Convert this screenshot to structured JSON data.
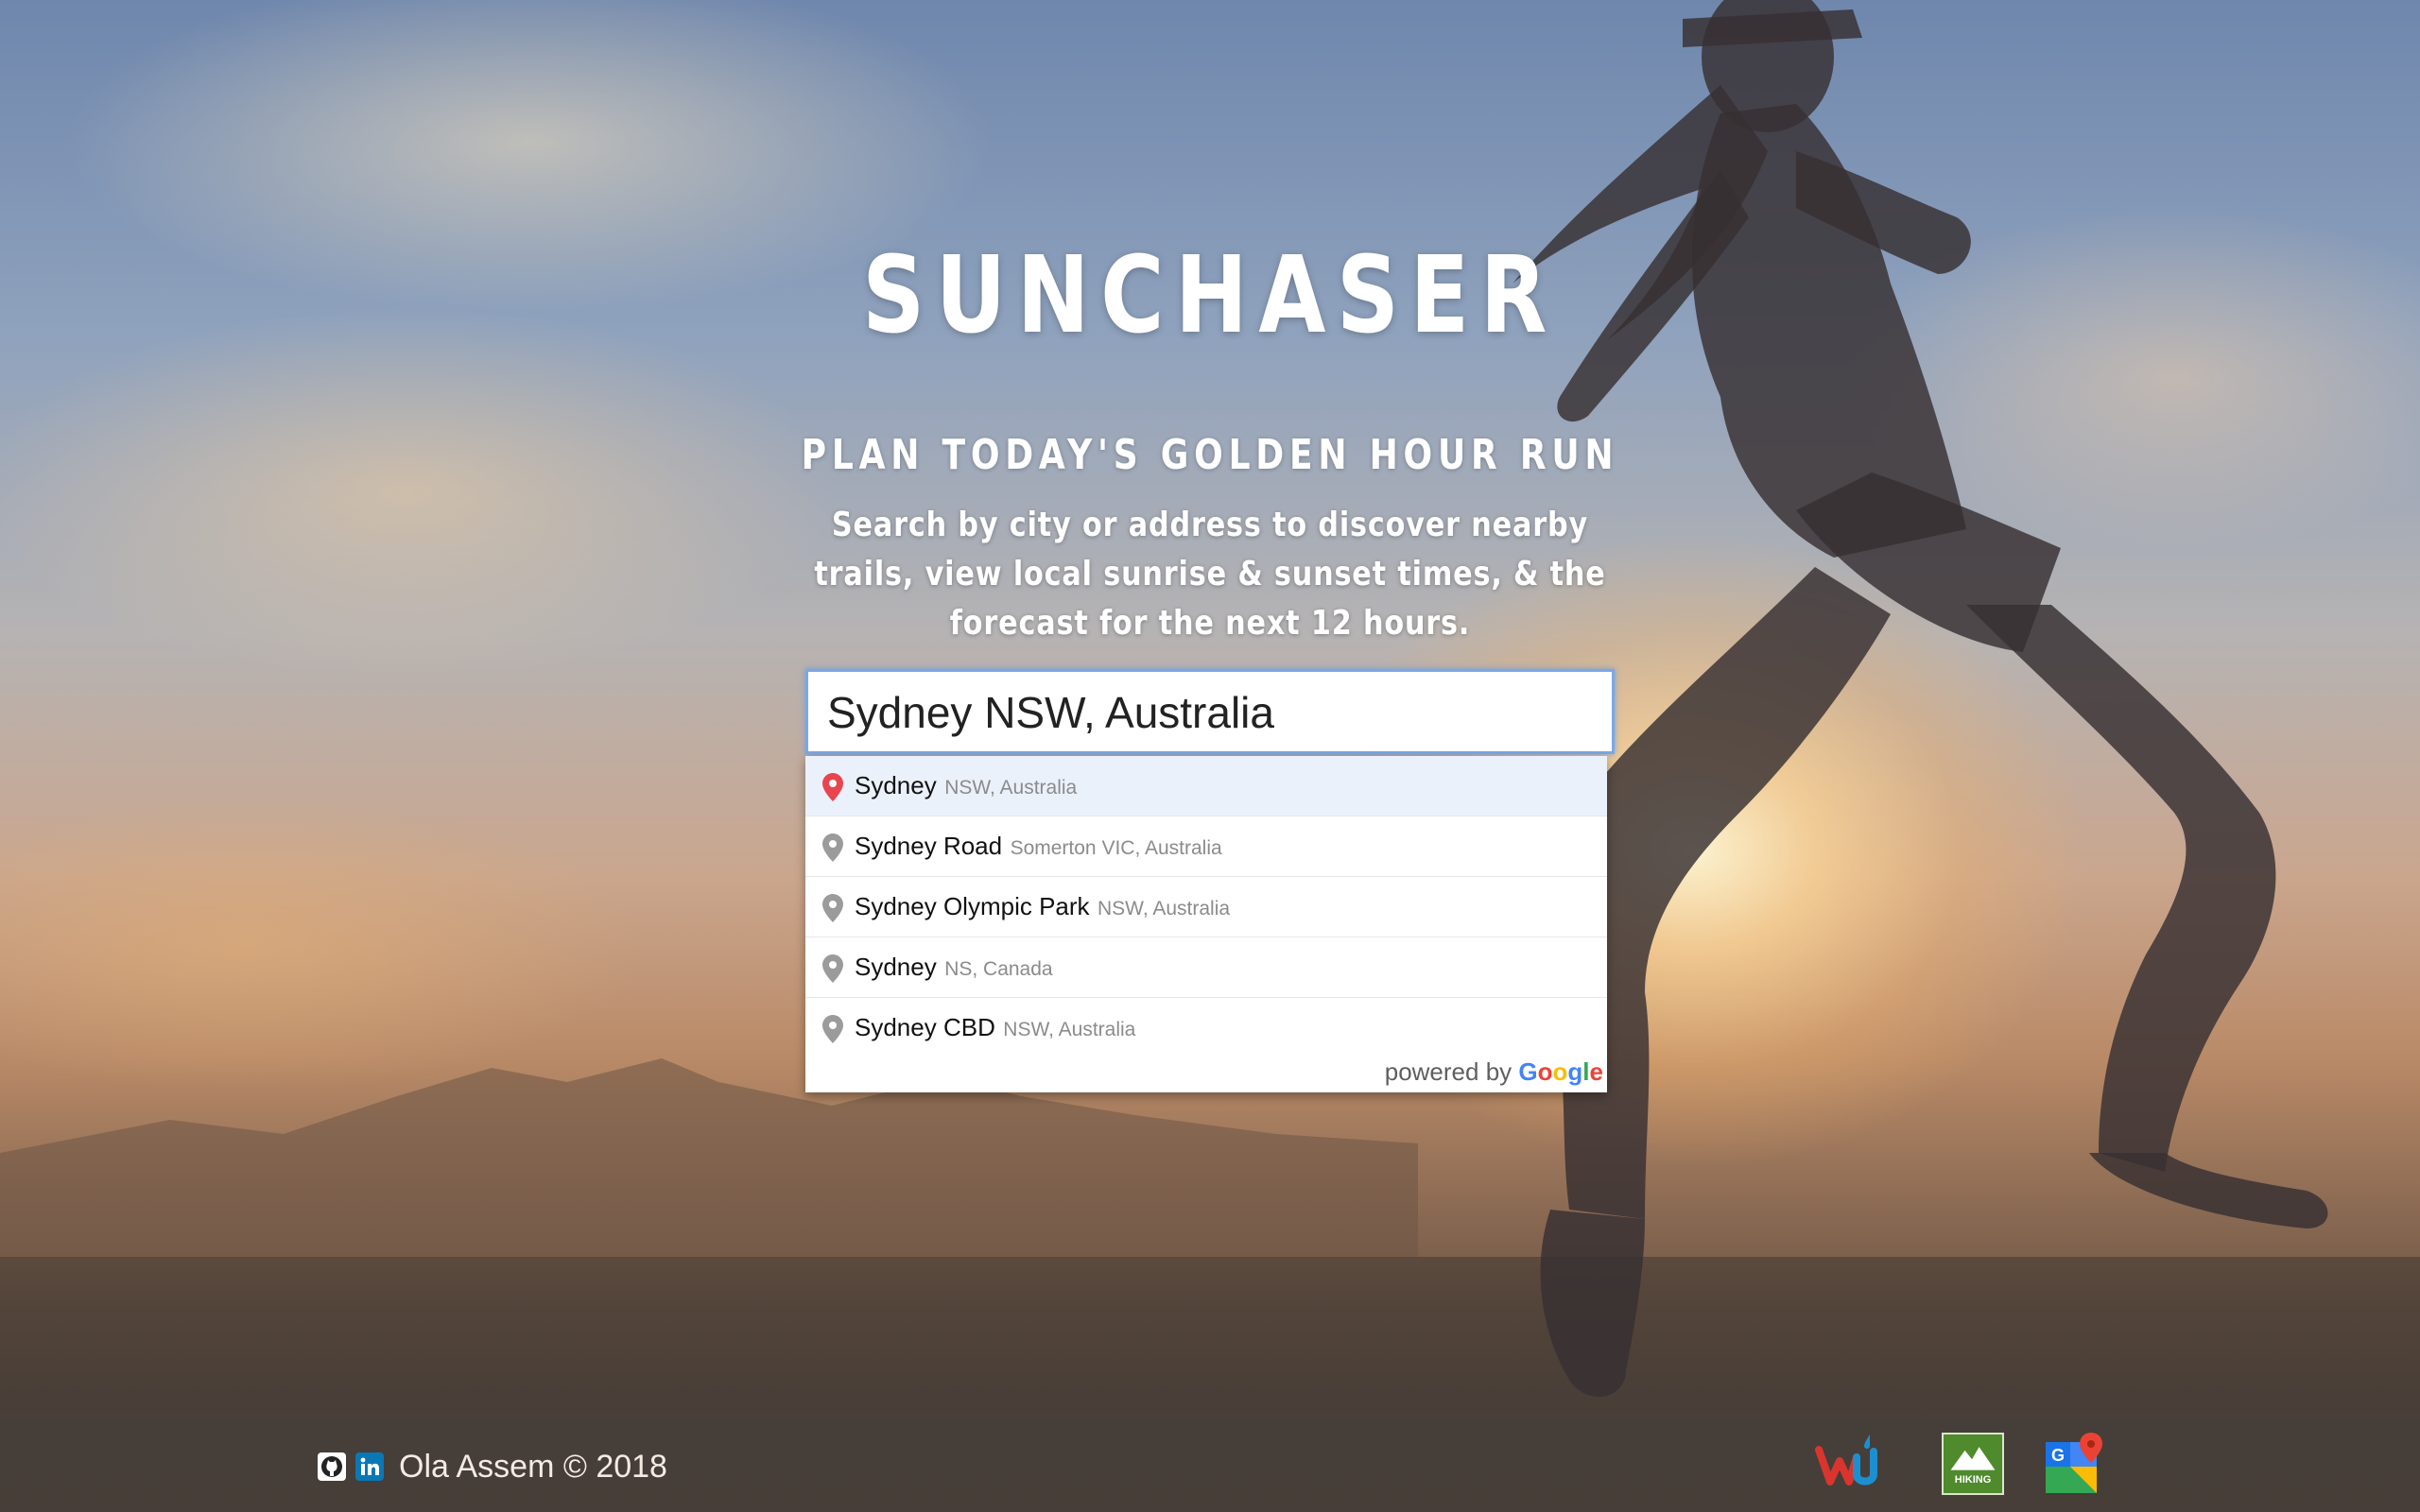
{
  "app": {
    "title": "SUNCHASER",
    "subtitle": "PLAN TODAY'S GOLDEN HOUR RUN",
    "description": "Search by city or address to discover nearby trails, view local sunrise & sunset times, & the forecast for the next 12 hours."
  },
  "search": {
    "value": "Sydney NSW, Australia",
    "suggestions": [
      {
        "main": "Sydney",
        "secondary": "NSW, Australia",
        "active": true
      },
      {
        "main": "Sydney Road",
        "secondary": "Somerton VIC, Australia",
        "active": false
      },
      {
        "main": "Sydney Olympic Park",
        "secondary": "NSW, Australia",
        "active": false
      },
      {
        "main": "Sydney",
        "secondary": "NS, Canada",
        "active": false
      },
      {
        "main": "Sydney CBD",
        "secondary": "NSW, Australia",
        "active": false
      }
    ],
    "powered_by": "powered by",
    "google": "Google"
  },
  "footer": {
    "credit": "Ola Assem © 2018",
    "social_icons": [
      "github-icon",
      "linkedin-icon"
    ],
    "partner_logos": [
      "weather-underground-logo",
      "hiking-project-logo",
      "google-maps-logo"
    ],
    "hiking_logo_text": "HIKING"
  },
  "colors": {
    "accent_border": "#7aa8e8",
    "active_row": "#ebf1fb",
    "active_pin": "#e8454f",
    "inactive_pin": "#9b9b9b"
  }
}
